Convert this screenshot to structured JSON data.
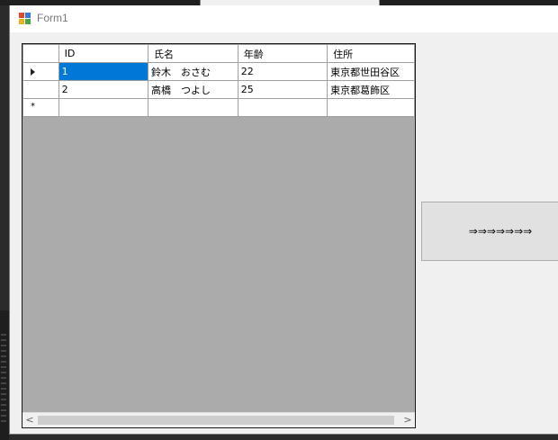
{
  "window": {
    "title": "Form1"
  },
  "grid": {
    "columns": [
      "ID",
      "氏名",
      "年齢",
      "住所"
    ],
    "rows": [
      {
        "id": "1",
        "name": "鈴木　おさむ",
        "age": "22",
        "address": "東京都世田谷区",
        "current": true
      },
      {
        "id": "2",
        "name": "高橋　つよし",
        "age": "25",
        "address": "東京都葛飾区",
        "current": false
      }
    ],
    "new_row_marker": "*"
  },
  "button": {
    "label": "⇒⇒⇒⇒⇒⇒⇒"
  },
  "icons": {
    "app": "form-app-icon",
    "current_row": "row-pointer-icon",
    "scroll_left": "chevron-left-icon",
    "scroll_right": "chevron-right-icon"
  },
  "colors": {
    "selection": "#0078d7",
    "grid_background": "#ababab"
  }
}
